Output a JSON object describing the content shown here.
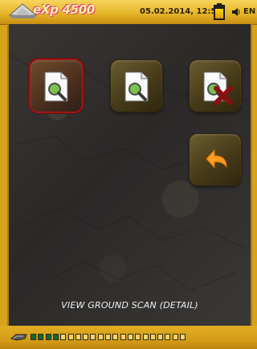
{
  "header": {
    "logo_text": "eXp 4500",
    "datetime": "05.02.2014, 12:56",
    "language": "EN",
    "battery_level_fraction": 0.85
  },
  "buttons": [
    {
      "name": "view-ground-scan-detail-button",
      "icon": "document-search-icon",
      "selected": true
    },
    {
      "name": "view-ground-scan-overview-button",
      "icon": "document-search-icon",
      "selected": false
    },
    {
      "name": "delete-scan-button",
      "icon": "document-delete-icon",
      "selected": false
    },
    {
      "name": "back-button",
      "icon": "back-arrow-icon",
      "selected": false
    }
  ],
  "status": {
    "text": "VIEW GROUND SCAN (DETAIL)"
  },
  "footer": {
    "progress_segments_total": 21,
    "progress_segments_filled": 4
  },
  "colors": {
    "accent_gold": "#e3aa1c",
    "panel_dark": "#2f2d2b",
    "selected_red": "#9e1717",
    "arrow_orange": "#ff9b1d"
  }
}
